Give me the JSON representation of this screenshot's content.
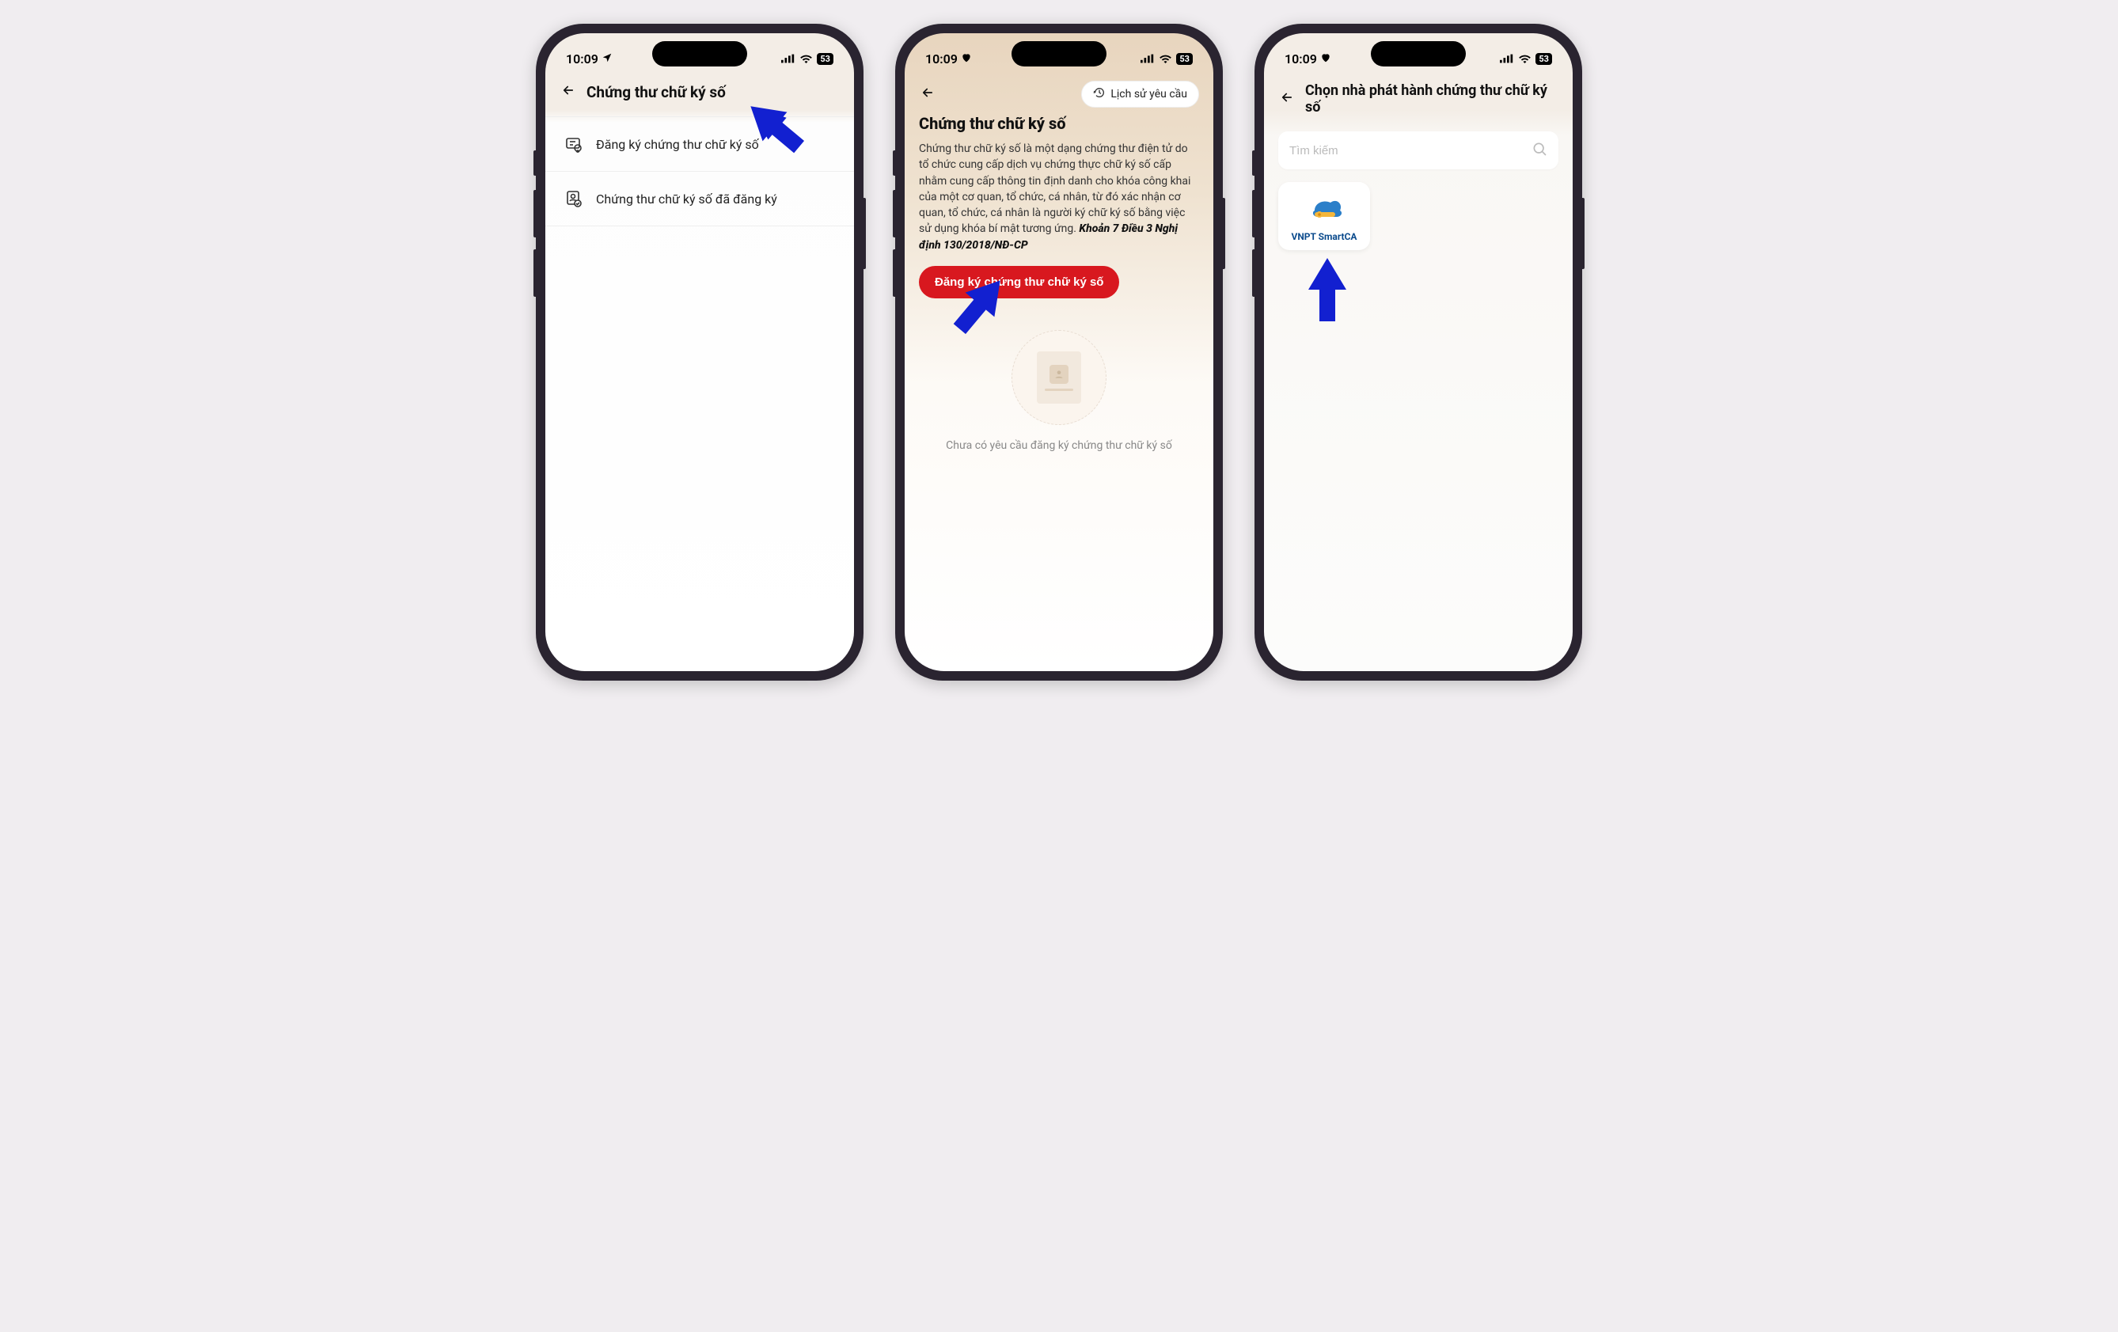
{
  "status": {
    "time": "10:09",
    "battery_label": "53",
    "location_icon": "location-arrow",
    "heart_icon": "heart"
  },
  "screen1": {
    "header_title": "Chứng thư chữ ký số",
    "item_register": "Đăng ký chứng thư chữ ký số",
    "item_registered": "Chứng thư chữ ký số đã đăng ký"
  },
  "screen2": {
    "history_btn": "Lịch sử yêu cầu",
    "title": "Chứng thư chữ ký số",
    "desc_part1": "Chứng thư chữ ký số là một dạng chứng thư điện tử do tổ chức cung cấp dịch vụ chứng thực chữ ký số cấp nhằm cung cấp thông tin định danh cho khóa công khai của một cơ quan, tổ chức, cá nhân, từ đó xác nhận cơ quan, tổ chức, cá nhân là người ký chữ ký số bằng việc sử dụng khóa bí mật tương ứng. ",
    "desc_bold": "Khoản 7 Điều 3 Nghị định 130/2018/NĐ-CP",
    "register_btn": "Đăng ký chứng thư chữ ký số",
    "empty_text": "Chưa có yêu cầu đăng ký chứng thư chữ ký số"
  },
  "screen3": {
    "header_title": "Chọn nhà phát hành chứng thư chữ ký số",
    "search_placeholder": "Tìm kiếm",
    "card_label": "VNPT SmartCA"
  }
}
